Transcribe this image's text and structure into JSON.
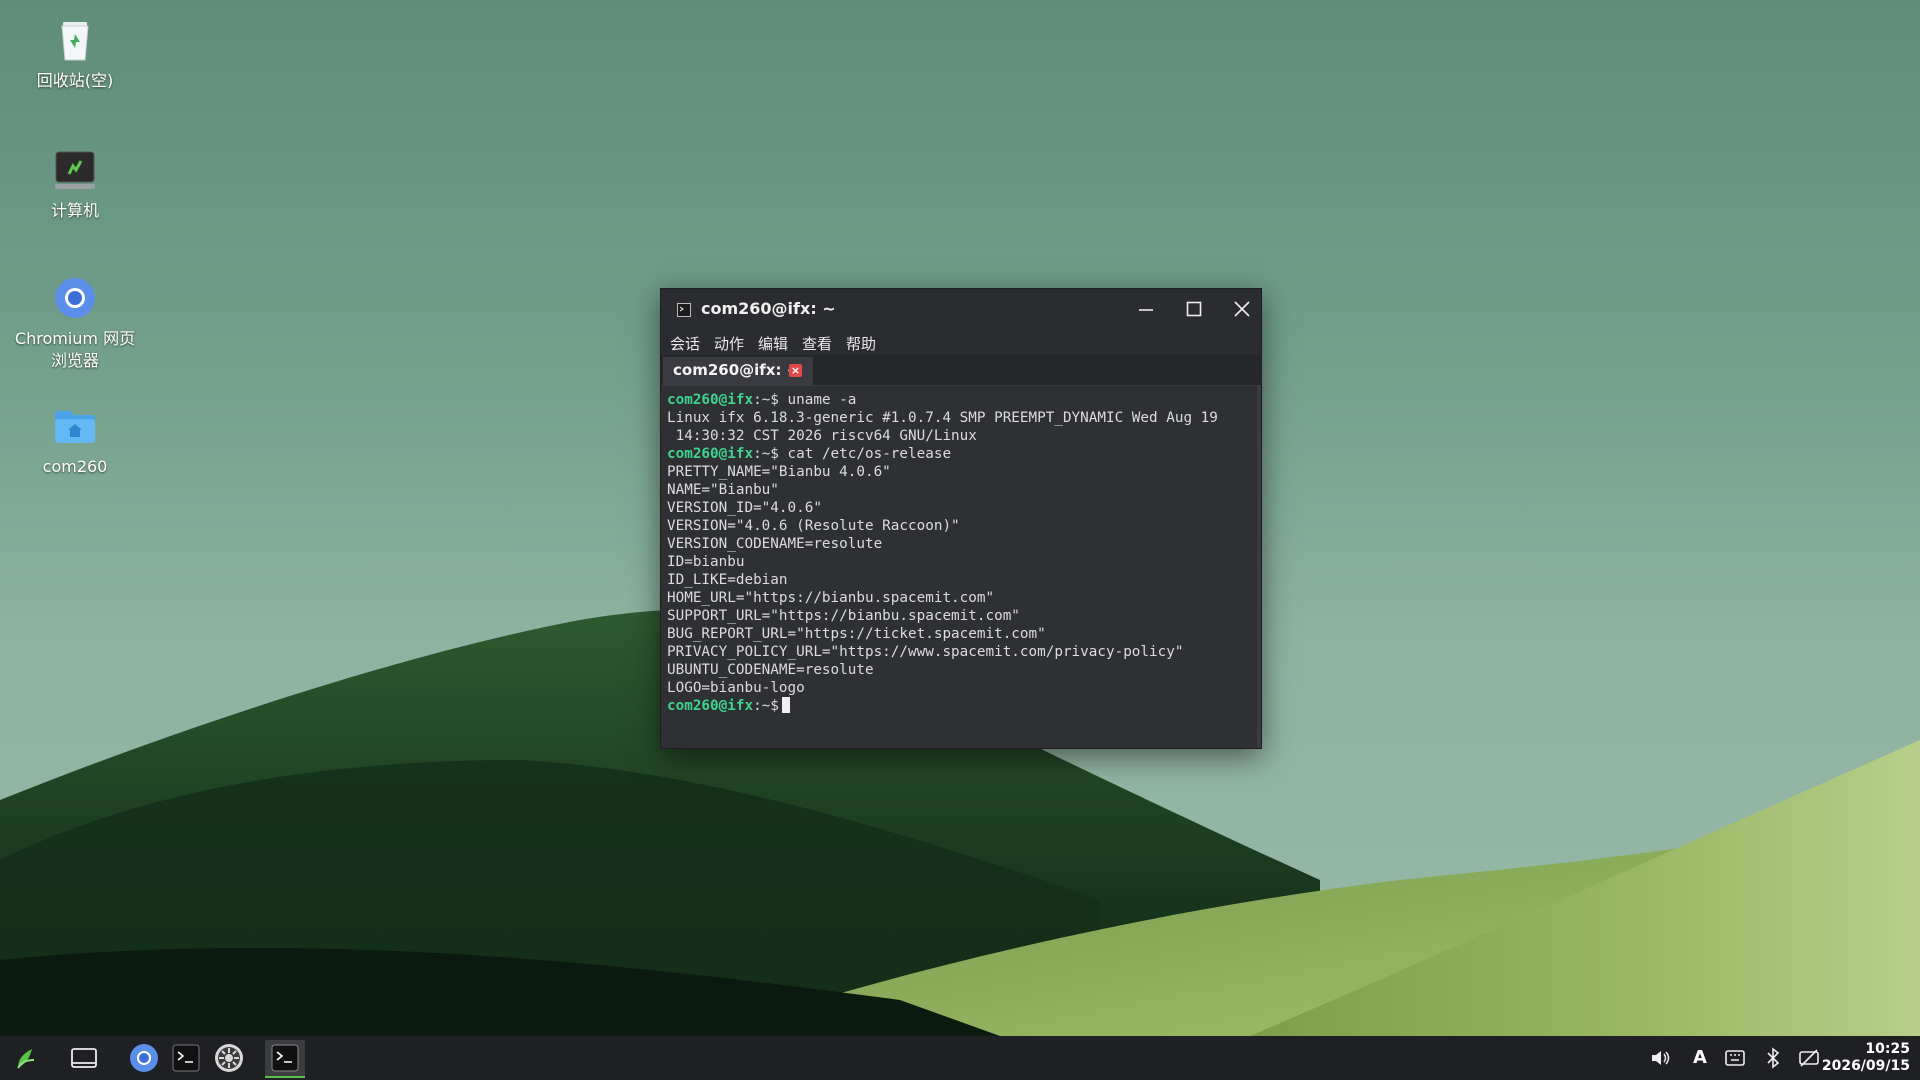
{
  "desktop": {
    "icons": [
      {
        "label": "回收站(空)"
      },
      {
        "label": "计算机"
      },
      {
        "label": "Chromium 网页\n浏览器"
      },
      {
        "label": "com260"
      }
    ]
  },
  "terminal": {
    "title": "com260@ifx: ~",
    "menu": [
      "会话",
      "动作",
      "编辑",
      "查看",
      "帮助"
    ],
    "tab_label": "com260@ifx: ~",
    "tab_close_glyph": "×",
    "prompt": "com260@ifx",
    "prompt_suffix": ":~$",
    "lines": [
      {
        "type": "cmd",
        "text": " uname -a"
      },
      {
        "type": "out",
        "text": "Linux ifx 6.18.3-generic #1.0.7.4 SMP PREEMPT_DYNAMIC Wed Aug 19"
      },
      {
        "type": "out",
        "text": " 14:30:32 CST 2026 riscv64 GNU/Linux"
      },
      {
        "type": "cmd",
        "text": " cat /etc/os-release"
      },
      {
        "type": "out",
        "text": "PRETTY_NAME=\"Bianbu 4.0.6\""
      },
      {
        "type": "out",
        "text": "NAME=\"Bianbu\""
      },
      {
        "type": "out",
        "text": "VERSION_ID=\"4.0.6\""
      },
      {
        "type": "out",
        "text": "VERSION=\"4.0.6 (Resolute Raccoon)\""
      },
      {
        "type": "out",
        "text": "VERSION_CODENAME=resolute"
      },
      {
        "type": "out",
        "text": "ID=bianbu"
      },
      {
        "type": "out",
        "text": "ID_LIKE=debian"
      },
      {
        "type": "out",
        "text": "HOME_URL=\"https://bianbu.spacemit.com\""
      },
      {
        "type": "out",
        "text": "SUPPORT_URL=\"https://bianbu.spacemit.com\""
      },
      {
        "type": "out",
        "text": "BUG_REPORT_URL=\"https://ticket.spacemit.com\""
      },
      {
        "type": "out",
        "text": "PRIVACY_POLICY_URL=\"https://www.spacemit.com/privacy-policy\""
      },
      {
        "type": "out",
        "text": "UBUNTU_CODENAME=resolute"
      },
      {
        "type": "out",
        "text": "LOGO=bianbu-logo"
      },
      {
        "type": "prompt",
        "text": " "
      }
    ]
  },
  "taskbar": {
    "clock_time": "10:25",
    "clock_date": "2026/09/15",
    "ime_label": "A"
  }
}
